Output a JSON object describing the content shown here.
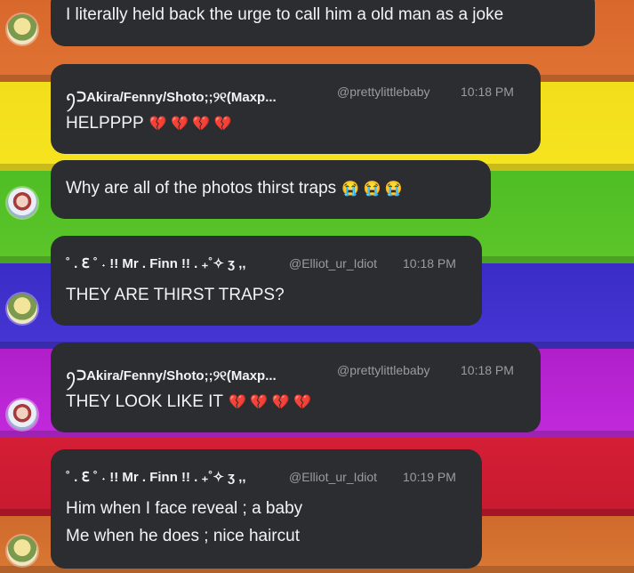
{
  "messages": [
    {
      "text": "I literally held back the urge to call him a old man as a joke"
    },
    {
      "author": "ꪆᑐAkira/Fenny/Shoto;;୨୧(Maxp...",
      "handle": "@prettylittlebaby",
      "time": "10:18 PM",
      "text": "HELPPPP",
      "reaction": "💔 💔 💔 💔"
    },
    {
      "text": "Why are all of the photos thirst traps",
      "reaction": "😭 😭 😭"
    },
    {
      "author": "˚ . ℇ ˚ ˖ !! Mr . Finn !! . ₊˚✧ ʒ ,,",
      "handle": "@Elliot_ur_Idiot",
      "time": "10:18 PM",
      "text": "THEY ARE THIRST TRAPS?"
    },
    {
      "author": "ꪆᑐAkira/Fenny/Shoto;;୨୧(Maxp...",
      "handle": "@prettylittlebaby",
      "time": "10:18 PM",
      "text": "THEY LOOK LIKE IT",
      "reaction": "💔 💔 💔 💔"
    },
    {
      "author": "˚ . ℇ ˚ ˖ !! Mr . Finn !! . ₊˚✧ ʒ ,,",
      "handle": "@Elliot_ur_Idiot",
      "time": "10:19 PM",
      "text": "Him when I face reveal ; a baby",
      "text2": "Me when he does ; nice haircut"
    }
  ],
  "colors": {
    "bubble": "#2b2d31",
    "text": "#f2f3f5",
    "muted": "#9a9ca2",
    "heart": "#ff4f86"
  }
}
